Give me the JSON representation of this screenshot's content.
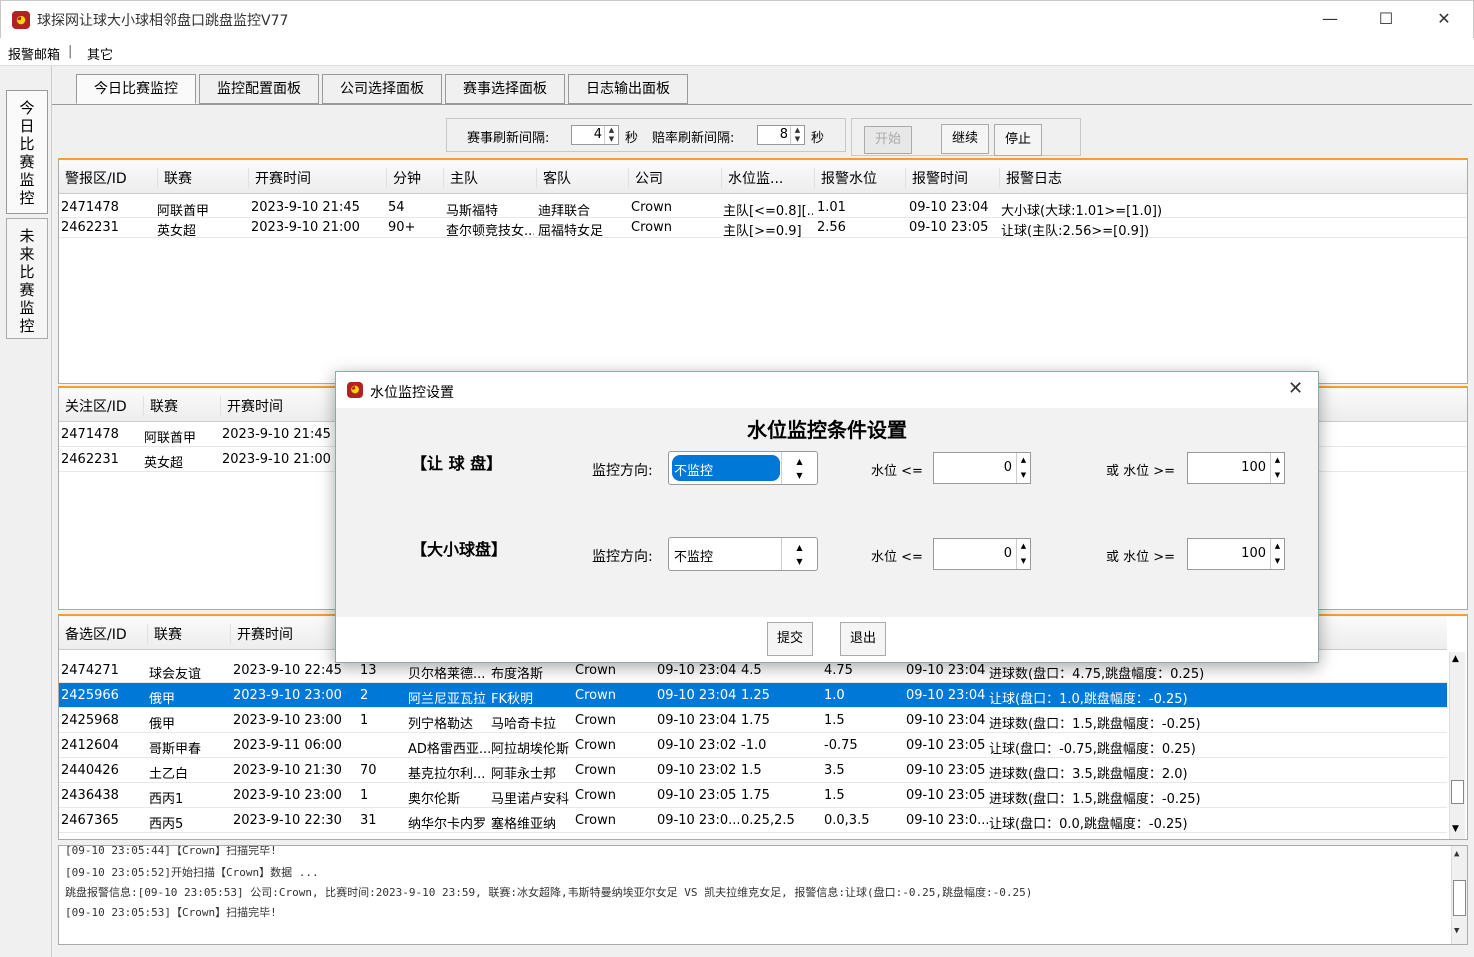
{
  "window": {
    "title": "球探网让球大小球相邻盘口跳盘监控V77",
    "minimize": "—",
    "maximize": "☐",
    "close": "✕"
  },
  "menu": {
    "items": [
      "报警邮箱",
      "|",
      "其它"
    ]
  },
  "side_tabs": [
    "今日比赛监控",
    "未来比赛监控"
  ],
  "tabs": [
    "今日比赛监控",
    "监控配置面板",
    "公司选择面板",
    "赛事选择面板",
    "日志输出面板"
  ],
  "refresh": {
    "match_label": "赛事刷新间隔:",
    "match_value": "4",
    "match_unit": "秒",
    "odds_label": "赔率刷新间隔:",
    "odds_value": "8",
    "odds_unit": "秒",
    "start": "开始",
    "continue": "继续",
    "stop": "停止"
  },
  "alarm_table": {
    "headers": [
      "警报区/ID",
      "联赛",
      "开赛时间",
      "分钟",
      "主队",
      "客队",
      "公司",
      "水位监...",
      "报警水位",
      "报警时间",
      "报警日志"
    ],
    "rows": [
      [
        "2471478",
        "阿联酋甲",
        "2023-9-10 21:45",
        "54",
        "马斯福特",
        "迪拜联合",
        "Crown",
        "主队[<=0.8][...",
        "1.01",
        "09-10 23:04",
        "大小球(大球:1.01>=[1.0])"
      ],
      [
        "2462231",
        "英女超",
        "2023-9-10 21:00",
        "90+",
        "查尔顿竞技女...",
        "屈福特女足",
        "Crown",
        "主队[>=0.9]",
        "2.56",
        "09-10 23:05",
        "让球(主队:2.56>=[0.9])"
      ]
    ]
  },
  "watch_table": {
    "headers": [
      "关注区/ID",
      "联赛",
      "开赛时间"
    ],
    "rows": [
      [
        "2471478",
        "阿联酋甲",
        "2023-9-10 21:45"
      ],
      [
        "2462231",
        "英女超",
        "2023-9-10 21:00"
      ]
    ]
  },
  "backup_table": {
    "headers": [
      "备选区/ID",
      "联赛",
      "开赛时间"
    ],
    "rows": [
      [
        "2474271",
        "球会友谊",
        "2023-9-10 22:45",
        "13",
        "贝尔格莱德...",
        "布度洛斯",
        "Crown",
        "09-10 23:04",
        "4.5",
        "4.75",
        "09-10 23:04",
        "进球数(盘口：4.75,跳盘幅度：0.25)"
      ],
      [
        "2425966",
        "俄甲",
        "2023-9-10 23:00",
        "2",
        "阿兰尼亚瓦拉",
        "FK秋明",
        "Crown",
        "09-10 23:04",
        "1.25",
        "1.0",
        "09-10 23:04",
        "让球(盘口：1.0,跳盘幅度：-0.25)"
      ],
      [
        "2425968",
        "俄甲",
        "2023-9-10 23:00",
        "1",
        "列宁格勒达",
        "马哈奇卡拉",
        "Crown",
        "09-10 23:04",
        "1.75",
        "1.5",
        "09-10 23:04",
        "进球数(盘口：1.5,跳盘幅度：-0.25)"
      ],
      [
        "2412604",
        "哥斯甲春",
        "2023-9-11 06:00",
        "",
        "AD格雷西亚...",
        "阿拉胡埃伦斯",
        "Crown",
        "09-10 23:02",
        "-1.0",
        "-0.75",
        "09-10 23:05",
        "让球(盘口：-0.75,跳盘幅度：0.25)"
      ],
      [
        "2440426",
        "土乙白",
        "2023-9-10 21:30",
        "70",
        "基克拉尔利...",
        "阿菲永士邦",
        "Crown",
        "09-10 23:02",
        "1.5",
        "3.5",
        "09-10 23:05",
        "进球数(盘口：3.5,跳盘幅度：2.0)"
      ],
      [
        "2436438",
        "西丙1",
        "2023-9-10 23:00",
        "1",
        "奥尔伦斯",
        "马里诺卢安科",
        "Crown",
        "09-10 23:05",
        "1.75",
        "1.5",
        "09-10 23:05",
        "进球数(盘口：1.5,跳盘幅度：-0.25)"
      ],
      [
        "2467365",
        "西丙5",
        "2023-9-10 22:30",
        "31",
        "纳华尔卡内罗",
        "塞格维亚纳",
        "Crown",
        "09-10 23:0...",
        "0.25,2.5",
        "0.0,3.5",
        "09-10 23:0...",
        "让球(盘口：0.0,跳盘幅度：-0.25)"
      ]
    ]
  },
  "log": {
    "lines": [
      "[09-10 23:05:44]【Crown】扫描完毕!",
      "[09-10 23:05:52]开始扫描【Crown】数据 ...",
      "跳盘报警信息:[09-10 23:05:53]  公司:Crown,  比赛时间:2023-9-10 23:59,  联赛:冰女超降,韦斯特曼纳埃亚尔女足 VS 凯夫拉维克女足,  报警信息:让球(盘口:-0.25,跳盘幅度:-0.25)",
      "[09-10 23:05:53]【Crown】扫描完毕!"
    ]
  },
  "dialog": {
    "title": "水位监控设置",
    "heading": "水位监控条件设置",
    "close": "✕",
    "handicap": {
      "label": "【让 球 盘】",
      "direction_label": "监控方向:",
      "direction_value": "不监控",
      "low_label": "水位 <=",
      "low_value": "0",
      "high_label": "或 水位 >=",
      "high_value": "100"
    },
    "overunder": {
      "label": "【大小球盘】",
      "direction_label": "监控方向:",
      "direction_value": "不监控",
      "low_label": "水位 <=",
      "low_value": "0",
      "high_label": "或 水位 >=",
      "high_value": "100"
    },
    "submit": "提交",
    "exit": "退出"
  },
  "colors": {
    "accent": "#0078d7",
    "orange_border": "#f0a030",
    "logo_bg": "#b22222"
  }
}
